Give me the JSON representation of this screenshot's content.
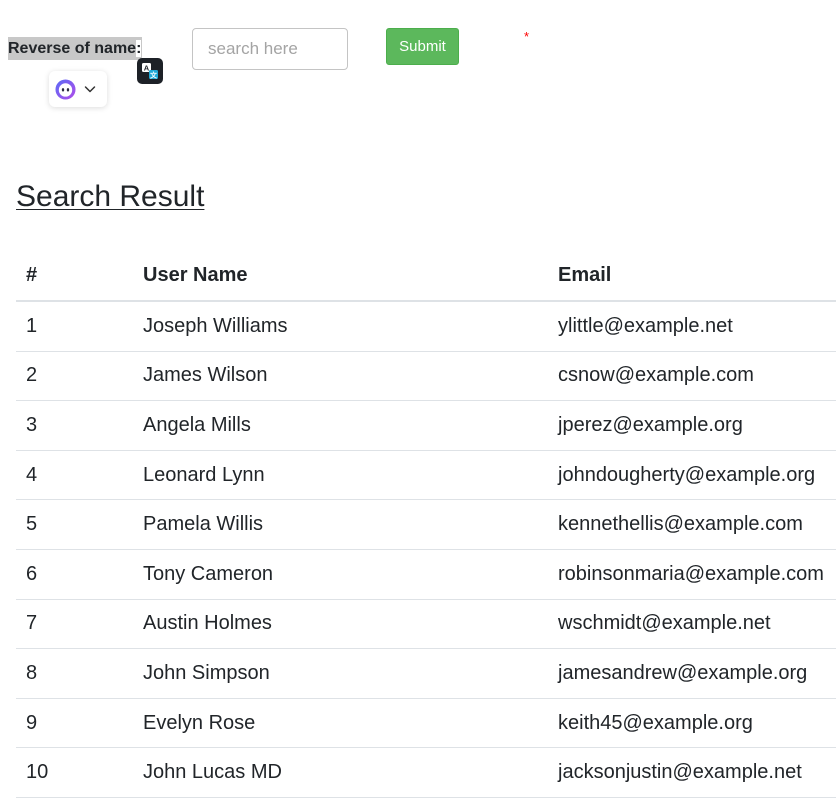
{
  "form": {
    "label_main": "Reverse of name",
    "label_colon": ":",
    "search_placeholder": "search here",
    "search_value": "",
    "submit_label": "Submit",
    "required_marker": "*"
  },
  "extensions": {
    "translate_icon": "translate-icon",
    "assistant_icon": "assistant-logo-icon",
    "dropdown_icon": "chevron-down-icon"
  },
  "results": {
    "title": "Search Result",
    "columns": [
      "#",
      "User Name",
      "Email"
    ],
    "rows": [
      [
        "1",
        "Joseph Williams",
        "ylittle@example.net"
      ],
      [
        "2",
        "James Wilson",
        "csnow@example.com"
      ],
      [
        "3",
        "Angela Mills",
        "jperez@example.org"
      ],
      [
        "4",
        "Leonard Lynn",
        "johndougherty@example.org"
      ],
      [
        "5",
        "Pamela Willis",
        "kennethellis@example.com"
      ],
      [
        "6",
        "Tony Cameron",
        "robinsonmaria@example.com"
      ],
      [
        "7",
        "Austin Holmes",
        "wschmidt@example.net"
      ],
      [
        "8",
        "John Simpson",
        "jamesandrew@example.org"
      ],
      [
        "9",
        "Evelyn Rose",
        "keith45@example.org"
      ],
      [
        "10",
        "John Lucas MD",
        "jacksonjustin@example.net"
      ]
    ]
  },
  "colors": {
    "submit_background": "#5cb85c",
    "label_highlight": "#c8c8c8",
    "required_star": "#ff0000"
  }
}
